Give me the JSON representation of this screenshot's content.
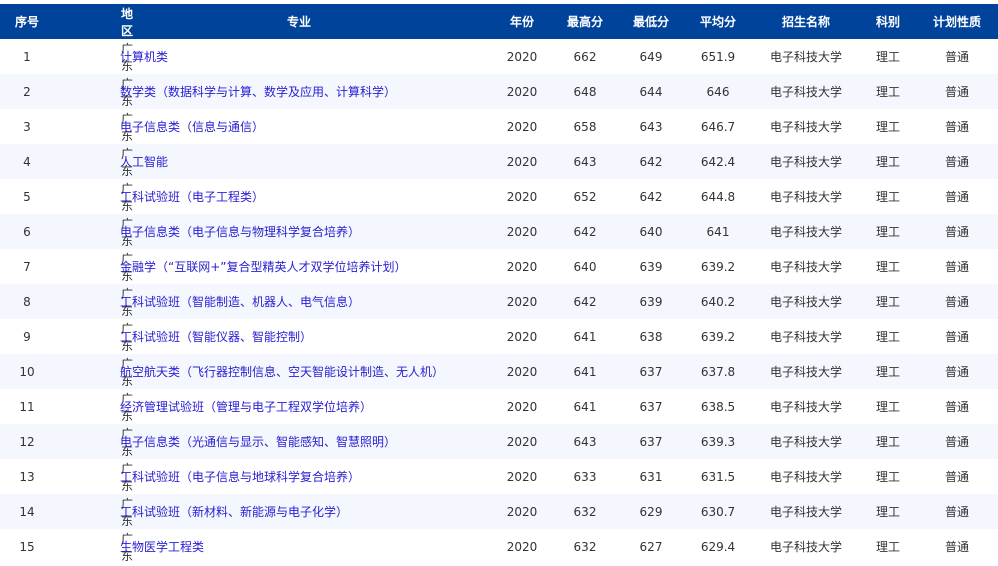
{
  "headers": [
    "序号",
    "地区",
    "专业",
    "年份",
    "最高分",
    "最低分",
    "平均分",
    "招生名称",
    "科别",
    "计划性质"
  ],
  "rows": [
    [
      "1",
      "广东",
      "计算机类",
      "2020",
      "662",
      "649",
      "651.9",
      "电子科技大学",
      "理工",
      "普通"
    ],
    [
      "2",
      "广东",
      "数学类（数据科学与计算、数学及应用、计算科学）",
      "2020",
      "648",
      "644",
      "646",
      "电子科技大学",
      "理工",
      "普通"
    ],
    [
      "3",
      "广东",
      "电子信息类（信息与通信）",
      "2020",
      "658",
      "643",
      "646.7",
      "电子科技大学",
      "理工",
      "普通"
    ],
    [
      "4",
      "广东",
      "人工智能",
      "2020",
      "643",
      "642",
      "642.4",
      "电子科技大学",
      "理工",
      "普通"
    ],
    [
      "5",
      "广东",
      "工科试验班（电子工程类）",
      "2020",
      "652",
      "642",
      "644.8",
      "电子科技大学",
      "理工",
      "普通"
    ],
    [
      "6",
      "广东",
      "电子信息类（电子信息与物理科学复合培养）",
      "2020",
      "642",
      "640",
      "641",
      "电子科技大学",
      "理工",
      "普通"
    ],
    [
      "7",
      "广东",
      "金融学（“互联网+”复合型精英人才双学位培养计划）",
      "2020",
      "640",
      "639",
      "639.2",
      "电子科技大学",
      "理工",
      "普通"
    ],
    [
      "8",
      "广东",
      "工科试验班（智能制造、机器人、电气信息）",
      "2020",
      "642",
      "639",
      "640.2",
      "电子科技大学",
      "理工",
      "普通"
    ],
    [
      "9",
      "广东",
      "工科试验班（智能仪器、智能控制）",
      "2020",
      "641",
      "638",
      "639.2",
      "电子科技大学",
      "理工",
      "普通"
    ],
    [
      "10",
      "广东",
      "航空航天类（飞行器控制信息、空天智能设计制造、无人机）",
      "2020",
      "641",
      "637",
      "637.8",
      "电子科技大学",
      "理工",
      "普通"
    ],
    [
      "11",
      "广东",
      "经济管理试验班（管理与电子工程双学位培养）",
      "2020",
      "641",
      "637",
      "638.5",
      "电子科技大学",
      "理工",
      "普通"
    ],
    [
      "12",
      "广东",
      "电子信息类（光通信与显示、智能感知、智慧照明）",
      "2020",
      "643",
      "637",
      "639.3",
      "电子科技大学",
      "理工",
      "普通"
    ],
    [
      "13",
      "广东",
      "工科试验班（电子信息与地球科学复合培养）",
      "2020",
      "633",
      "631",
      "631.5",
      "电子科技大学",
      "理工",
      "普通"
    ],
    [
      "14",
      "广东",
      "工科试验班（新材料、新能源与电子化学）",
      "2020",
      "632",
      "629",
      "630.7",
      "电子科技大学",
      "理工",
      "普通"
    ],
    [
      "15",
      "广东",
      "生物医学工程类",
      "2020",
      "632",
      "627",
      "629.4",
      "电子科技大学",
      "理工",
      "普通"
    ]
  ]
}
